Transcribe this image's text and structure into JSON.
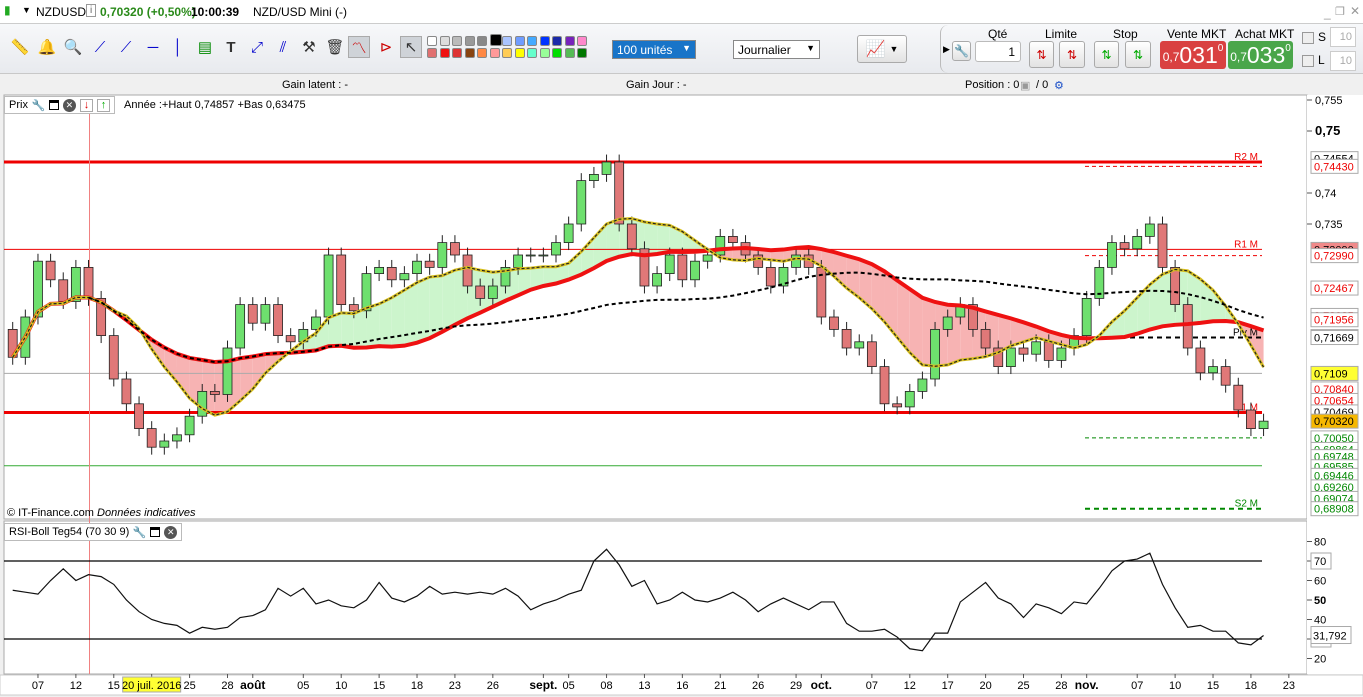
{
  "title": {
    "symbol": "NZDUSD",
    "price": "0,70320 (+0,50%)",
    "time": "10:00:39",
    "name": "NZD/USD Mini (-)"
  },
  "toolbar": {
    "quantity_select": "100 unités",
    "period_select": "Journalier",
    "palette_row1": [
      "#ffffff",
      "#dddddd",
      "#bbbbbb",
      "#999999",
      "#888888",
      "#000000",
      "#aac4ff",
      "#6f9cff",
      "#44aaff",
      "#0033ff",
      "#1a2aa8",
      "#7722bb",
      "#ff88cc"
    ],
    "palette_row2": [
      "#e07070",
      "#ee1111",
      "#dd3333",
      "#884411",
      "#ff8844",
      "#ff9999",
      "#ffcc55",
      "#ffff00",
      "#66ffcc",
      "#99ff99",
      "#00dd00",
      "#55bb55",
      "#007700"
    ]
  },
  "trade": {
    "qty_label": "Qté",
    "qty_value": "1",
    "limit_label": "Limite",
    "stop_label": "Stop",
    "sell_label": "Vente MKT",
    "sell_prefix": "0,7",
    "sell_main": "031",
    "sell_exp": "0",
    "buy_label": "Achat MKT",
    "buy_prefix": "0,7",
    "buy_main": "033",
    "buy_exp": "0",
    "s_label": "S",
    "s_value": "10",
    "l_label": "L",
    "l_value": "10",
    "sell_color": "#d94141",
    "buy_color": "#4aa64a"
  },
  "info": {
    "gain_latent": "Gain latent :  -",
    "gain_jour": "Gain Jour :  -",
    "position": "Position :  0",
    "position2": "/  0"
  },
  "price_legend": {
    "label": "Prix",
    "text": "Année :+Haut 0,74857 +Bas 0,63475"
  },
  "rsi_legend": {
    "label": "RSI-Boll Teg54 (70 30 9)"
  },
  "copyright": {
    "site": "© IT-Finance.com",
    "note": "Données indicatives"
  },
  "chart_data": {
    "type": "candlestick",
    "symbol": "NZDUSD",
    "period": "daily",
    "first_open": 0.718,
    "close": [
      0.7135,
      0.72,
      0.729,
      0.726,
      0.7225,
      0.728,
      0.723,
      0.717,
      0.71,
      0.706,
      0.702,
      0.699,
      0.7,
      0.701,
      0.704,
      0.708,
      0.7075,
      0.715,
      0.722,
      0.719,
      0.722,
      0.717,
      0.716,
      0.718,
      0.72,
      0.73,
      0.722,
      0.721,
      0.727,
      0.728,
      0.726,
      0.727,
      0.729,
      0.728,
      0.732,
      0.73,
      0.725,
      0.723,
      0.725,
      0.728,
      0.73,
      0.73,
      0.73,
      0.732,
      0.735,
      0.742,
      0.743,
      0.745,
      0.735,
      0.731,
      0.725,
      0.727,
      0.73,
      0.726,
      0.729,
      0.73,
      0.733,
      0.732,
      0.73,
      0.728,
      0.725,
      0.728,
      0.73,
      0.728,
      0.72,
      0.718,
      0.715,
      0.716,
      0.712,
      0.706,
      0.7055,
      0.708,
      0.71,
      0.718,
      0.72,
      0.722,
      0.718,
      0.715,
      0.712,
      0.715,
      0.714,
      0.716,
      0.713,
      0.715,
      0.717,
      0.723,
      0.728,
      0.732,
      0.731,
      0.733,
      0.735,
      0.728,
      0.722,
      0.715,
      0.711,
      0.712,
      0.709,
      0.705,
      0.702,
      0.7032
    ],
    "ma_periods": {
      "short": 9,
      "medium": 25,
      "long": 50
    },
    "levels": [
      {
        "name": "R2 M",
        "value": 0.745,
        "color": "#ee0000",
        "style": "thick"
      },
      {
        "name": "R1 M",
        "value": 0.7309,
        "color": "#ee0000",
        "style": "thin"
      },
      {
        "name": "Piv M",
        "value": 0.71669,
        "color": "#000000",
        "style": "dash-right"
      },
      {
        "name": "",
        "value": 0.7109,
        "color": "#aaaaaa",
        "style": "thin"
      },
      {
        "name": "S1 M",
        "value": 0.7046,
        "color": "#ee0000",
        "style": "thick"
      },
      {
        "name": "",
        "value": 0.696,
        "color": "#33aa33",
        "style": "thin"
      },
      {
        "name": "S2 M",
        "value": 0.68908,
        "color": "#008800",
        "style": "dash-right"
      }
    ],
    "right_dashes": [
      {
        "value": 0.7443,
        "color": "#ee0000"
      },
      {
        "value": 0.7299,
        "color": "#ee0000"
      },
      {
        "value": 0.7005,
        "color": "#008800"
      }
    ],
    "y_ticks": [
      {
        "v": 0.755,
        "t": "0,755"
      },
      {
        "v": 0.75,
        "t": "0,75",
        "bold": true
      },
      {
        "v": 0.74,
        "t": "0,74"
      },
      {
        "v": 0.735,
        "t": "0,735"
      }
    ],
    "y_labels": [
      {
        "v": 0.74554,
        "t": "0,74554",
        "c": "#000000",
        "bg": "#ffffff"
      },
      {
        "v": 0.7443,
        "t": "0,74430",
        "c": "#ee0000",
        "bg": "#ffffff"
      },
      {
        "v": 0.7309,
        "t": "0,73090",
        "c": "#000000",
        "bg": "#f08a8a"
      },
      {
        "v": 0.7299,
        "t": "0,72990",
        "c": "#ee0000",
        "bg": "#ffffff"
      },
      {
        "v": 0.72467,
        "t": "0,72467",
        "c": "#ee0000",
        "bg": "#ffffff"
      },
      {
        "v": 0.72025,
        "t": "0,72025",
        "c": "#ee0000",
        "bg": "#ffffff"
      },
      {
        "v": 0.71956,
        "t": "0,71956",
        "c": "#ee0000",
        "bg": "#ffffff"
      },
      {
        "v": 0.71684,
        "t": "0,71684",
        "c": "#000000",
        "bg": "#ffffff"
      },
      {
        "v": 0.71669,
        "t": "0,71669",
        "c": "#000000",
        "bg": "#ffffff"
      },
      {
        "v": 0.7109,
        "t": "0,7109",
        "c": "#000000",
        "bg": "#ffff33"
      },
      {
        "v": 0.7084,
        "t": "0,70840",
        "c": "#ee0000",
        "bg": "#ffffff"
      },
      {
        "v": 0.70654,
        "t": "0,70654",
        "c": "#ee0000",
        "bg": "#ffffff"
      },
      {
        "v": 0.70469,
        "t": "0,70469",
        "c": "#000000",
        "bg": "#ffffff"
      },
      {
        "v": 0.7032,
        "t": "0,70320",
        "c": "#000000",
        "bg": "#f6b800"
      },
      {
        "v": 0.7005,
        "t": "0,70050",
        "c": "#008800",
        "bg": "#ffffff"
      },
      {
        "v": 0.69864,
        "t": "0,69864",
        "c": "#008800",
        "bg": "#ffffff"
      },
      {
        "v": 0.69748,
        "t": "0,69748",
        "c": "#008800",
        "bg": "#ffffff"
      },
      {
        "v": 0.69585,
        "t": "0,69585",
        "c": "#008800",
        "bg": "#ffffff"
      },
      {
        "v": 0.69446,
        "t": "0,69446",
        "c": "#008800",
        "bg": "#ffffff"
      },
      {
        "v": 0.6926,
        "t": "0,69260",
        "c": "#008800",
        "bg": "#ffffff"
      },
      {
        "v": 0.69074,
        "t": "0,69074",
        "c": "#008800",
        "bg": "#ffffff"
      },
      {
        "v": 0.68908,
        "t": "0,68908",
        "c": "#008800",
        "bg": "#ffffff"
      }
    ],
    "rsi": {
      "values": [
        55,
        54,
        53,
        60,
        66,
        60,
        63,
        62,
        58,
        50,
        44,
        40,
        38,
        37,
        33,
        36,
        35,
        36,
        41,
        42,
        45,
        56,
        52,
        56,
        48,
        50,
        47,
        46,
        50,
        59,
        51,
        49,
        52,
        57,
        53,
        54,
        53,
        54,
        53,
        56,
        52,
        45,
        48,
        50,
        53,
        55,
        70,
        76,
        68,
        57,
        60,
        48,
        50,
        54,
        50,
        49,
        51,
        54,
        50,
        44,
        48,
        51,
        48,
        45,
        49,
        49,
        38,
        34,
        34,
        35,
        31,
        25,
        24,
        33,
        33,
        49,
        54,
        59,
        51,
        48,
        41,
        48,
        46,
        43,
        49,
        48,
        56,
        65,
        70,
        71,
        74,
        58,
        46,
        36,
        37,
        34,
        34,
        28,
        27,
        31.792
      ],
      "upper": 70,
      "lower": 30,
      "ylim": [
        15,
        88
      ],
      "ticks": [
        {
          "v": 80,
          "t": "80"
        },
        {
          "v": 70,
          "t": "70",
          "box": true
        },
        {
          "v": 60,
          "t": "60"
        },
        {
          "v": 50,
          "t": "50",
          "bold": true
        },
        {
          "v": 40,
          "t": "40"
        },
        {
          "v": 30,
          "t": "30",
          "box": true
        },
        {
          "v": 20,
          "t": "20"
        }
      ],
      "last_label": "31,792"
    },
    "x_labels": [
      {
        "i": 2,
        "t": "07"
      },
      {
        "i": 5,
        "t": "12"
      },
      {
        "i": 8,
        "t": "15"
      },
      {
        "i": 11,
        "t": "20 juil. 2016",
        "hl": true
      },
      {
        "i": 14,
        "t": "25"
      },
      {
        "i": 17,
        "t": "28"
      },
      {
        "i": 19,
        "t": "août",
        "bold": true
      },
      {
        "i": 23,
        "t": "05"
      },
      {
        "i": 26,
        "t": "10"
      },
      {
        "i": 29,
        "t": "15"
      },
      {
        "i": 32,
        "t": "18"
      },
      {
        "i": 35,
        "t": "23"
      },
      {
        "i": 38,
        "t": "26"
      },
      {
        "i": 42,
        "t": "sept.",
        "bold": true
      },
      {
        "i": 44,
        "t": "05"
      },
      {
        "i": 47,
        "t": "08"
      },
      {
        "i": 50,
        "t": "13"
      },
      {
        "i": 53,
        "t": "16"
      },
      {
        "i": 56,
        "t": "21"
      },
      {
        "i": 59,
        "t": "26"
      },
      {
        "i": 62,
        "t": "29"
      },
      {
        "i": 64,
        "t": "oct.",
        "bold": true
      },
      {
        "i": 68,
        "t": "07"
      },
      {
        "i": 71,
        "t": "12"
      },
      {
        "i": 74,
        "t": "17"
      },
      {
        "i": 77,
        "t": "20"
      },
      {
        "i": 80,
        "t": "25"
      },
      {
        "i": 83,
        "t": "28"
      },
      {
        "i": 85,
        "t": "nov.",
        "bold": true
      },
      {
        "i": 89,
        "t": "07"
      },
      {
        "i": 92,
        "t": "10"
      },
      {
        "i": 95,
        "t": "15"
      },
      {
        "i": 98,
        "t": "18"
      },
      {
        "i": 101,
        "t": "23"
      }
    ],
    "crosshair_index": 6
  }
}
